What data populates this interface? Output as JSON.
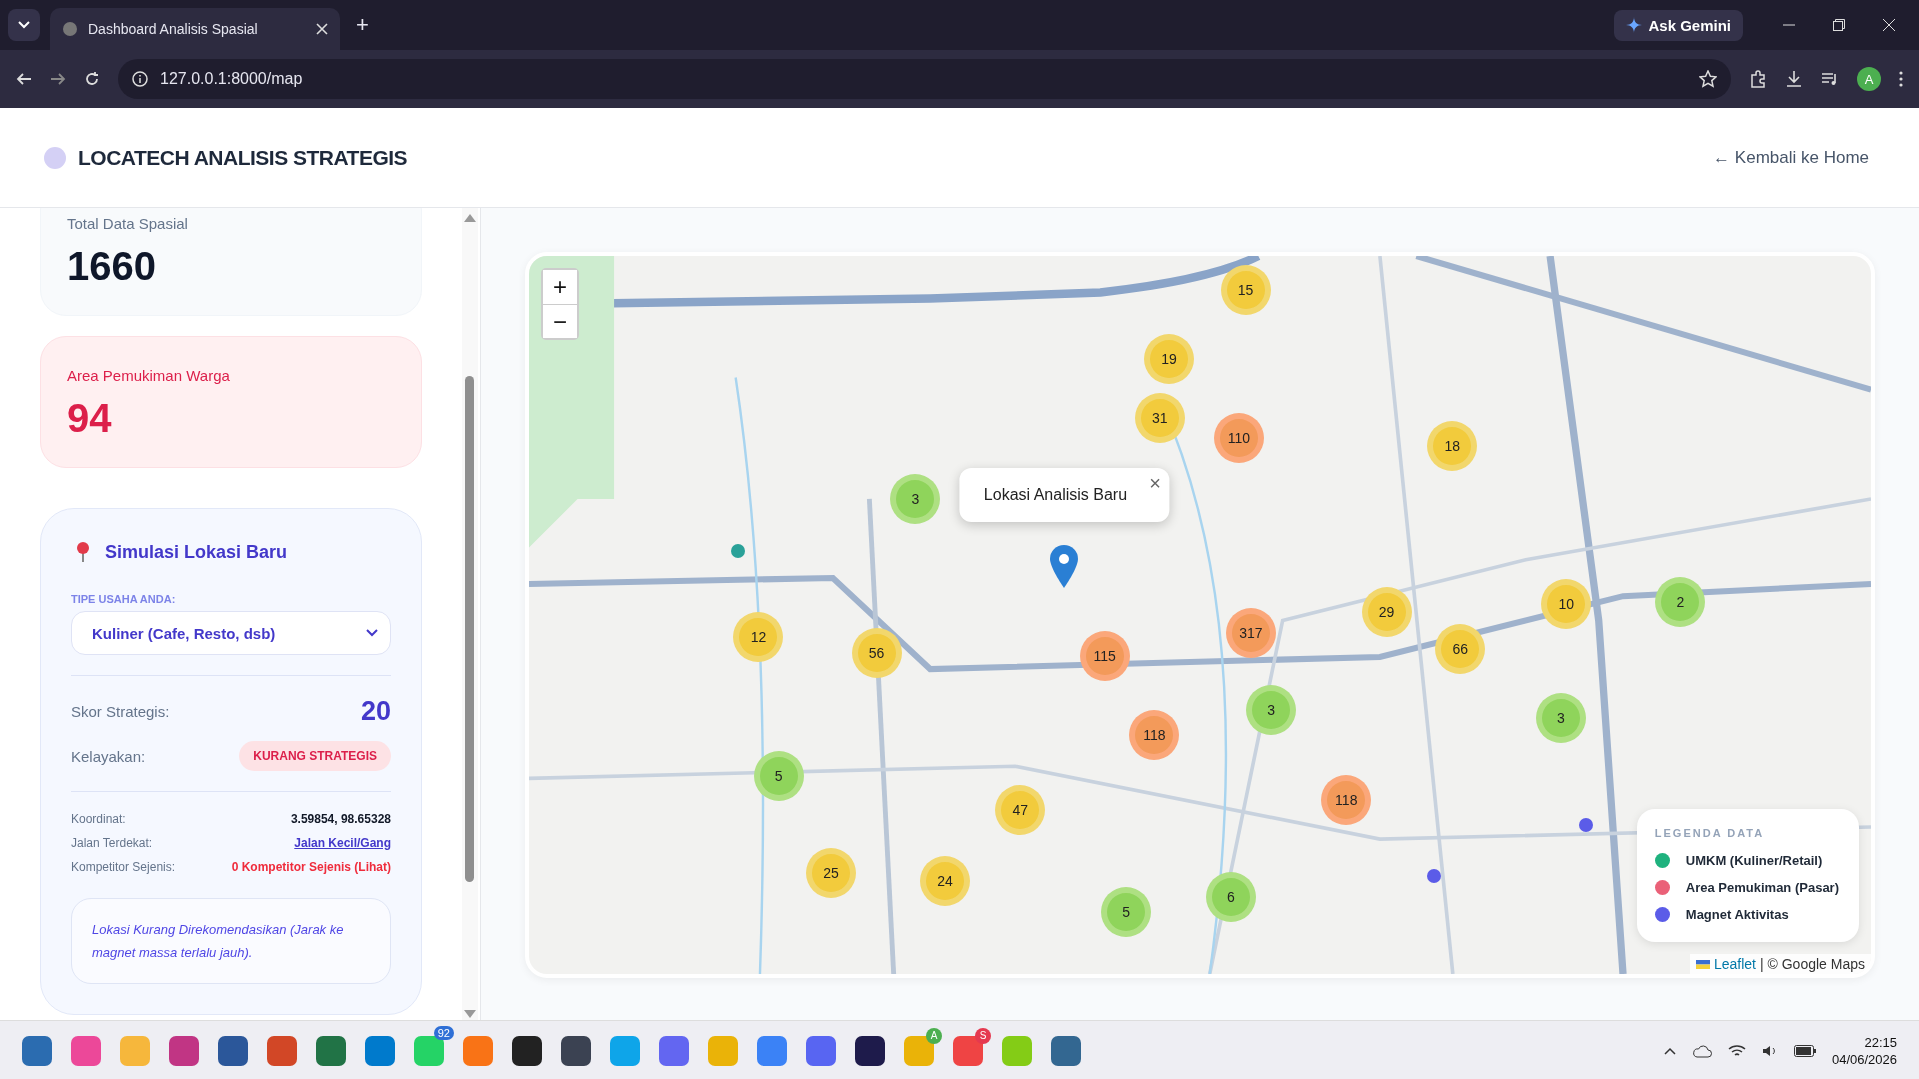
{
  "browser": {
    "tab_title": "Dashboard Analisis Spasial",
    "new_tab": "+",
    "gemini": "Ask Gemini",
    "url": "127.0.0.1:8000/map",
    "profile": "A"
  },
  "header": {
    "title": "LOCATECH ANALISIS STRATEGIS",
    "back_link": "← Kembali ke Home"
  },
  "stats": [
    {
      "label": "Total Data Spasial",
      "value": "1660",
      "kind": "neutral"
    },
    {
      "label": "Area Pemukiman Warga",
      "value": "94",
      "kind": "alert"
    }
  ],
  "simulation": {
    "title": "Simulasi Lokasi Baru",
    "business_type_label": "TIPE USAHA ANDA:",
    "business_type": "Kuliner (Cafe, Resto, dsb)",
    "score_label": "Skor Strategis:",
    "score": "20",
    "feasibility_label": "Kelayakan:",
    "feasibility": "KURANG STRATEGIS",
    "details": [
      {
        "label": "Koordinat:",
        "value": "3.59854, 98.65328",
        "kind": "plain"
      },
      {
        "label": "Jalan Terdekat:",
        "value": "Jalan Kecil/Gang",
        "kind": "link"
      },
      {
        "label": "Kompetitor Sejenis:",
        "value": "0 Kompetitor Sejenis (Lihat)",
        "kind": "warning"
      }
    ],
    "note": "Lokasi Kurang Direkomendasikan (Jarak ke magnet massa terlalu jauh)."
  },
  "map": {
    "zoom_in": "+",
    "zoom_out": "−",
    "popup": "Lokasi Analisis Baru",
    "popup_close": "×",
    "clusters": [
      {
        "count": "15",
        "kind": "medium"
      },
      {
        "count": "19",
        "kind": "medium"
      },
      {
        "count": "31",
        "kind": "medium"
      },
      {
        "count": "110",
        "kind": "large"
      },
      {
        "count": "18",
        "kind": "medium"
      },
      {
        "count": "3",
        "kind": "small"
      },
      {
        "count": "29",
        "kind": "medium"
      },
      {
        "count": "10",
        "kind": "medium"
      },
      {
        "count": "2",
        "kind": "small"
      },
      {
        "count": "12",
        "kind": "medium"
      },
      {
        "count": "56",
        "kind": "medium"
      },
      {
        "count": "317",
        "kind": "large"
      },
      {
        "count": "115",
        "kind": "large"
      },
      {
        "count": "66",
        "kind": "medium"
      },
      {
        "count": "3",
        "kind": "small"
      },
      {
        "count": "3",
        "kind": "small"
      },
      {
        "count": "118",
        "kind": "large"
      },
      {
        "count": "5",
        "kind": "small"
      },
      {
        "count": "47",
        "kind": "medium"
      },
      {
        "count": "118",
        "kind": "large"
      },
      {
        "count": "25",
        "kind": "medium"
      },
      {
        "count": "24",
        "kind": "medium"
      },
      {
        "count": "6",
        "kind": "small"
      },
      {
        "count": "5",
        "kind": "small"
      }
    ],
    "legend": {
      "title": "LEGENDA DATA",
      "items": [
        {
          "label": "UMKM (Kuliner/Retail)",
          "color": "#1fb27e"
        },
        {
          "label": "Area Pemukiman (Pasar)",
          "color": "#ea6178"
        },
        {
          "label": "Magnet Aktivitas",
          "color": "#5b5ce8"
        }
      ]
    },
    "attribution_link": "Leaflet",
    "attribution": "| © Google Maps"
  },
  "taskbar": {
    "whatsapp_badge": "92",
    "chrome_badges": [
      "A",
      "S"
    ],
    "time": "22:15",
    "date": "04/06/2026"
  }
}
